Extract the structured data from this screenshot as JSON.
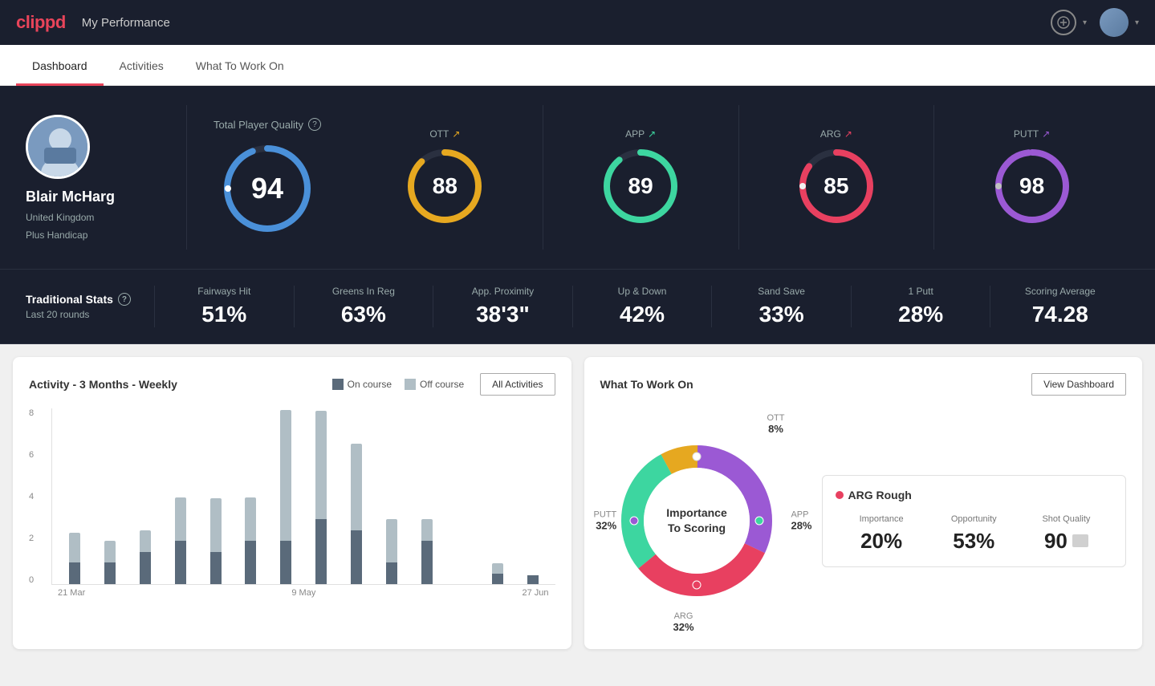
{
  "header": {
    "logo": "clippd",
    "title": "My Performance",
    "add_btn_label": "+",
    "dropdown_chevron": "▾"
  },
  "nav": {
    "tabs": [
      {
        "label": "Dashboard",
        "active": true
      },
      {
        "label": "Activities",
        "active": false
      },
      {
        "label": "What To Work On",
        "active": false
      }
    ]
  },
  "player": {
    "name": "Blair McHarg",
    "country": "United Kingdom",
    "handicap": "Plus Handicap"
  },
  "quality": {
    "total_label": "Total Player Quality",
    "total_value": "94",
    "metrics": [
      {
        "label": "OTT",
        "value": "88",
        "color": "#e6a820",
        "pct": 88
      },
      {
        "label": "APP",
        "value": "89",
        "color": "#3dd6a0",
        "pct": 89
      },
      {
        "label": "ARG",
        "value": "85",
        "color": "#e84060",
        "pct": 85
      },
      {
        "label": "PUTT",
        "value": "98",
        "color": "#9b59d4",
        "pct": 98
      }
    ]
  },
  "trad_stats": {
    "title": "Traditional Stats",
    "period": "Last 20 rounds",
    "items": [
      {
        "label": "Fairways Hit",
        "value": "51%"
      },
      {
        "label": "Greens In Reg",
        "value": "63%"
      },
      {
        "label": "App. Proximity",
        "value": "38'3\""
      },
      {
        "label": "Up & Down",
        "value": "42%"
      },
      {
        "label": "Sand Save",
        "value": "33%"
      },
      {
        "label": "1 Putt",
        "value": "28%"
      },
      {
        "label": "Scoring Average",
        "value": "74.28"
      }
    ]
  },
  "activity_chart": {
    "title": "Activity - 3 Months - Weekly",
    "legend": [
      {
        "label": "On course",
        "color": "#5a6a7a"
      },
      {
        "label": "Off course",
        "color": "#b0bec5"
      }
    ],
    "all_activities_label": "All Activities",
    "y_labels": [
      "0",
      "2",
      "4",
      "6",
      "8"
    ],
    "x_labels": [
      "21 Mar",
      "9 May",
      "27 Jun"
    ],
    "bars": [
      {
        "on": 1,
        "off": 1.5
      },
      {
        "on": 1,
        "off": 1
      },
      {
        "on": 1.5,
        "off": 1
      },
      {
        "on": 2,
        "off": 2
      },
      {
        "on": 1.5,
        "off": 2.5
      },
      {
        "on": 2,
        "off": 2
      },
      {
        "on": 2,
        "off": 6
      },
      {
        "on": 3,
        "off": 5
      },
      {
        "on": 2.5,
        "off": 4
      },
      {
        "on": 1,
        "off": 2
      },
      {
        "on": 2,
        "off": 1
      },
      {
        "on": 0,
        "off": 0
      },
      {
        "on": 0.5,
        "off": 0.2
      },
      {
        "on": 0.4,
        "off": 0
      }
    ]
  },
  "work_on": {
    "title": "What To Work On",
    "view_dashboard_label": "View Dashboard",
    "donut_center_line1": "Importance",
    "donut_center_line2": "To Scoring",
    "segments": [
      {
        "label": "OTT",
        "pct": "8%",
        "color": "#e6a820",
        "pos": "top"
      },
      {
        "label": "APP",
        "pct": "28%",
        "color": "#3dd6a0",
        "pos": "right"
      },
      {
        "label": "ARG",
        "pct": "32%",
        "color": "#e84060",
        "pos": "bottom"
      },
      {
        "label": "PUTT",
        "pct": "32%",
        "color": "#9b59d4",
        "pos": "left"
      }
    ],
    "info_card": {
      "title": "ARG Rough",
      "dot_color": "#e84060",
      "metrics": [
        {
          "label": "Importance",
          "value": "20%"
        },
        {
          "label": "Opportunity",
          "value": "53%"
        },
        {
          "label": "Shot Quality",
          "value": "90"
        }
      ]
    }
  }
}
